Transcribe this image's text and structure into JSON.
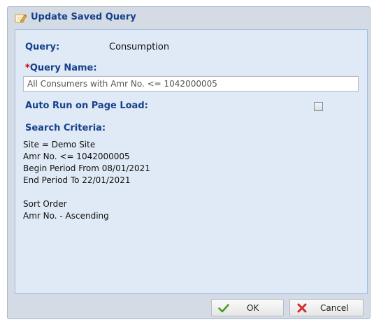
{
  "dialog": {
    "title": "Update Saved Query",
    "title_icon": "pencil-note-icon"
  },
  "form": {
    "query_label": "Query:",
    "query_value": "Consumption",
    "query_name_required_mark": "*",
    "query_name_label": "Query Name:",
    "query_name_value": "All Consumers with Amr No. <= 1042000005",
    "auto_run_label": "Auto Run on Page Load:",
    "auto_run_checked": false,
    "search_criteria_label": "Search Criteria:"
  },
  "criteria": {
    "lines": [
      "Site = Demo Site",
      "Amr No. <= 1042000005",
      "Begin Period From 08/01/2021",
      "End Period To 22/01/2021",
      "",
      "Sort Order",
      "Amr No. - Ascending"
    ]
  },
  "buttons": {
    "ok_label": "OK",
    "ok_icon": "checkmark-icon",
    "cancel_label": "Cancel",
    "cancel_icon": "red-x-icon"
  },
  "colors": {
    "label_blue": "#15428b",
    "required_red": "#cc0000",
    "panel_bg": "#e0e9f6",
    "frame_bg": "#d4dbe5"
  }
}
